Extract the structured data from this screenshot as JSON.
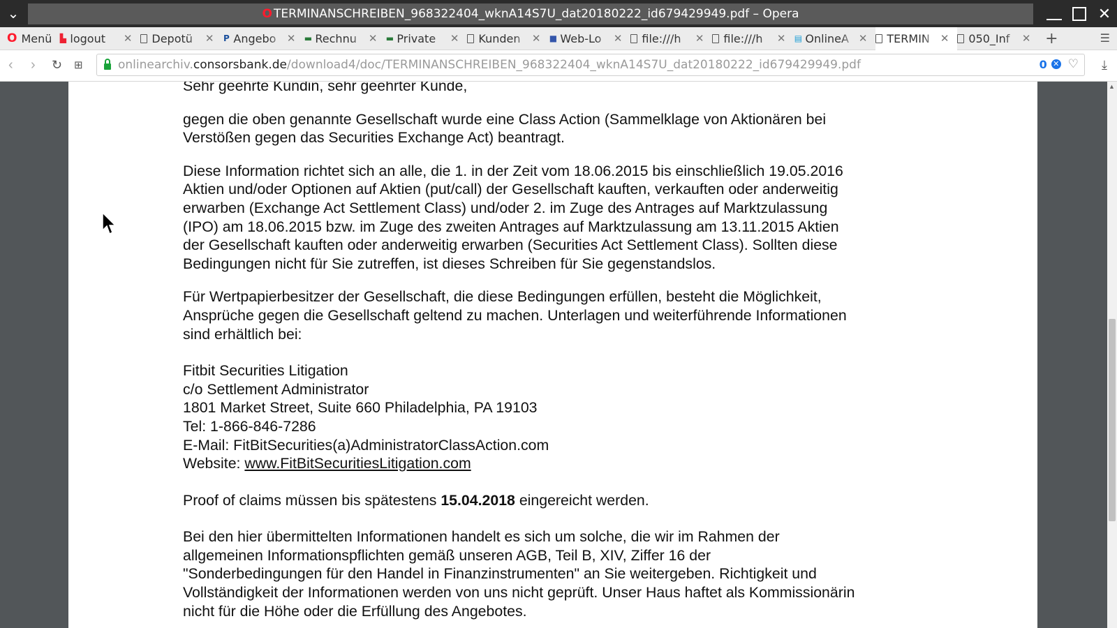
{
  "window": {
    "title": "TERMINANSCHREIBEN_968322404_wknA14S7U_dat20180222_id679429949.pdf – Opera"
  },
  "tabs": {
    "menu_label": "Menü",
    "items": [
      {
        "label": "logout",
        "icon": "red-logo-icon"
      },
      {
        "label": "Depotü",
        "icon": "document-icon"
      },
      {
        "label": "Angebo",
        "icon": "paypal-icon"
      },
      {
        "label": "Rechnu",
        "icon": "dkv-icon"
      },
      {
        "label": "Private",
        "icon": "dkv-icon"
      },
      {
        "label": "Kunden",
        "icon": "document-icon"
      },
      {
        "label": "Web-Lo",
        "icon": "web-icon"
      },
      {
        "label": "file:///h",
        "icon": "document-icon"
      },
      {
        "label": "file:///h",
        "icon": "document-icon"
      },
      {
        "label": "OnlineA",
        "icon": "online-icon"
      },
      {
        "label": "TERMIN",
        "icon": "document-icon",
        "active": true
      },
      {
        "label": "050_Inf",
        "icon": "document-icon"
      }
    ]
  },
  "address": {
    "url_prefix": "onlinearchiv.",
    "url_host": "consorsbank.de",
    "url_path": "/download4/doc/TERMINANSCHREIBEN_968322404_wknA14S7U_dat20180222_id679429949.pdf",
    "blocked_count": "0"
  },
  "document": {
    "greeting": "Sehr geehrte Kundin, sehr geehrter Kunde,",
    "para1": [
      "gegen die oben genannte Gesellschaft wurde eine Class Action (Sammelklage von Aktionären bei",
      "Verstößen gegen das Securities Exchange Act) beantragt."
    ],
    "para2": [
      "Diese Information richtet sich an alle, die 1. in der Zeit vom 18.06.2015 bis einschließlich 19.05.2016",
      "Aktien und/oder Optionen auf Aktien (put/call) der Gesellschaft kauften, verkauften oder anderweitig",
      "erwarben (Exchange Act Settlement Class) und/oder 2. im Zuge des Antrages auf Marktzulassung",
      "(IPO) am 18.06.2015 bzw. im Zuge des zweiten Antrages auf Marktzulassung am 13.11.2015 Aktien",
      "der Gesellschaft kauften oder anderweitig erwarben (Securities Act Settlement Class). Sollten diese",
      "Bedingungen nicht für Sie zutreffen, ist dieses Schreiben für Sie gegenstandslos."
    ],
    "para3": [
      "Für Wertpapierbesitzer der Gesellschaft, die diese Bedingungen erfüllen, besteht die Möglichkeit,",
      "Ansprüche gegen die Gesellschaft geltend zu machen. Unterlagen und weiterführende Informationen",
      "sind erhältlich bei:"
    ],
    "address_block": [
      "Fitbit Securities Litigation",
      "c/o Settlement Administrator",
      "1801 Market Street, Suite 660 Philadelphia, PA 19103",
      "Tel: 1-866-846-7286",
      "E-Mail: FitBitSecurities(a)AdministratorClassAction.com"
    ],
    "website_label": "Website: ",
    "website_link": "www.FitBitSecuritiesLitigation.com",
    "proof_before": "Proof of claims müssen bis spätestens ",
    "proof_date": "15.04.2018",
    "proof_after": " eingereicht werden.",
    "para_final": [
      "Bei den hier übermittelten Informationen handelt es sich um solche, die wir im Rahmen der",
      "allgemeinen Informationspflichten gemäß unseren AGB, Teil B, XIV, Ziffer 16 der",
      "\"Sonderbedingungen für den Handel in Finanzinstrumenten\" an Sie weitergeben. Richtigkeit und",
      "Vollständigkeit der Informationen werden von uns nicht geprüft. Unser Haus haftet als Kommissionärin",
      "nicht für die Höhe oder die Erfüllung des Angebotes."
    ]
  },
  "colors": {
    "opera_red": "#ff1b2d",
    "link_blue": "#1a73e8",
    "secure_green": "#1aa33a"
  }
}
